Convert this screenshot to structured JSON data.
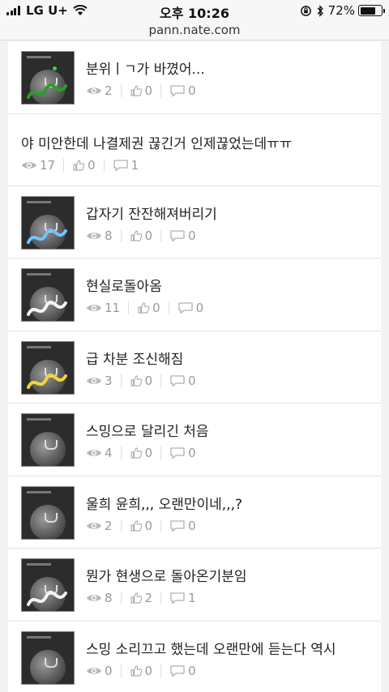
{
  "status": {
    "carrier": "LG U+",
    "time": "오후 10:26",
    "battery": "72%",
    "battery_level": 0.72
  },
  "url": "pann.nate.com",
  "posts": [
    {
      "title": "분위ㅣㄱ가 바꼈어...",
      "views": "2",
      "likes": "0",
      "comments": "0",
      "thumb": true,
      "scribble": "green"
    },
    {
      "title": "야 미안한데 나결제권 끊긴거 인제끊었는데ㅠㅠ",
      "views": "17",
      "likes": "0",
      "comments": "1",
      "thumb": false
    },
    {
      "title": "갑자기 잔잔해져버리기",
      "views": "8",
      "likes": "0",
      "comments": "0",
      "thumb": true,
      "scribble": "blue"
    },
    {
      "title": "현실로돌아옴",
      "views": "11",
      "likes": "0",
      "comments": "0",
      "thumb": true,
      "scribble": "white"
    },
    {
      "title": "급 차분 조신해짐",
      "views": "3",
      "likes": "0",
      "comments": "0",
      "thumb": true,
      "scribble": "yellow"
    },
    {
      "title": "스밍으로 달리긴 처음",
      "views": "4",
      "likes": "0",
      "comments": "0",
      "thumb": true,
      "scribble": "none"
    },
    {
      "title": "울희 윤희,,, 오랜만이네,,,?",
      "views": "2",
      "likes": "0",
      "comments": "0",
      "thumb": true,
      "scribble": "none"
    },
    {
      "title": "뭔가 현생으로 돌아온기분임",
      "views": "8",
      "likes": "2",
      "comments": "1",
      "thumb": true,
      "scribble": "white"
    },
    {
      "title": "스밍 소리끄고 했는데 오랜만에 듣는다 역시",
      "views": "0",
      "likes": "0",
      "comments": "0",
      "thumb": true,
      "scribble": "none"
    }
  ]
}
